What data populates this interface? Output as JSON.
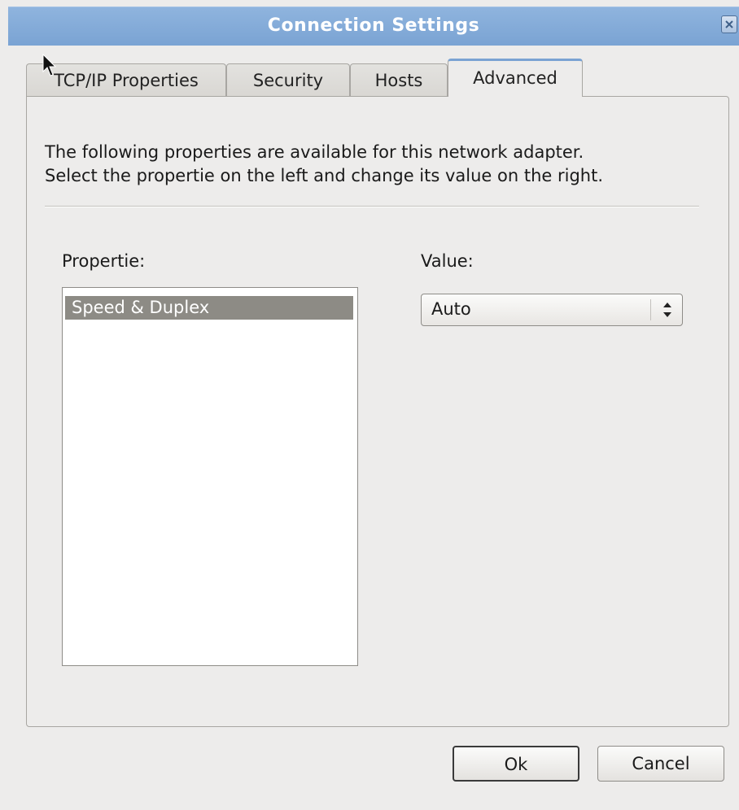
{
  "window": {
    "title": "Connection Settings",
    "accent_color": "#7aa3d3",
    "close_icon": "close-icon"
  },
  "tabs": [
    {
      "label": "TCP/IP Properties",
      "active": false
    },
    {
      "label": "Security",
      "active": false
    },
    {
      "label": "Hosts",
      "active": false
    },
    {
      "label": "Advanced",
      "active": true
    }
  ],
  "advanced": {
    "description_line1": "The following properties are available for this network adapter.",
    "description_line2": "Select the propertie on the left and change its value on the right.",
    "properties_label": "Propertie:",
    "value_label": "Value:",
    "properties": [
      {
        "label": "Speed & Duplex",
        "selected": true
      }
    ],
    "value_select": {
      "selected": "Auto",
      "icon": "updown-arrows-icon"
    }
  },
  "buttons": {
    "ok": "Ok",
    "cancel": "Cancel"
  }
}
